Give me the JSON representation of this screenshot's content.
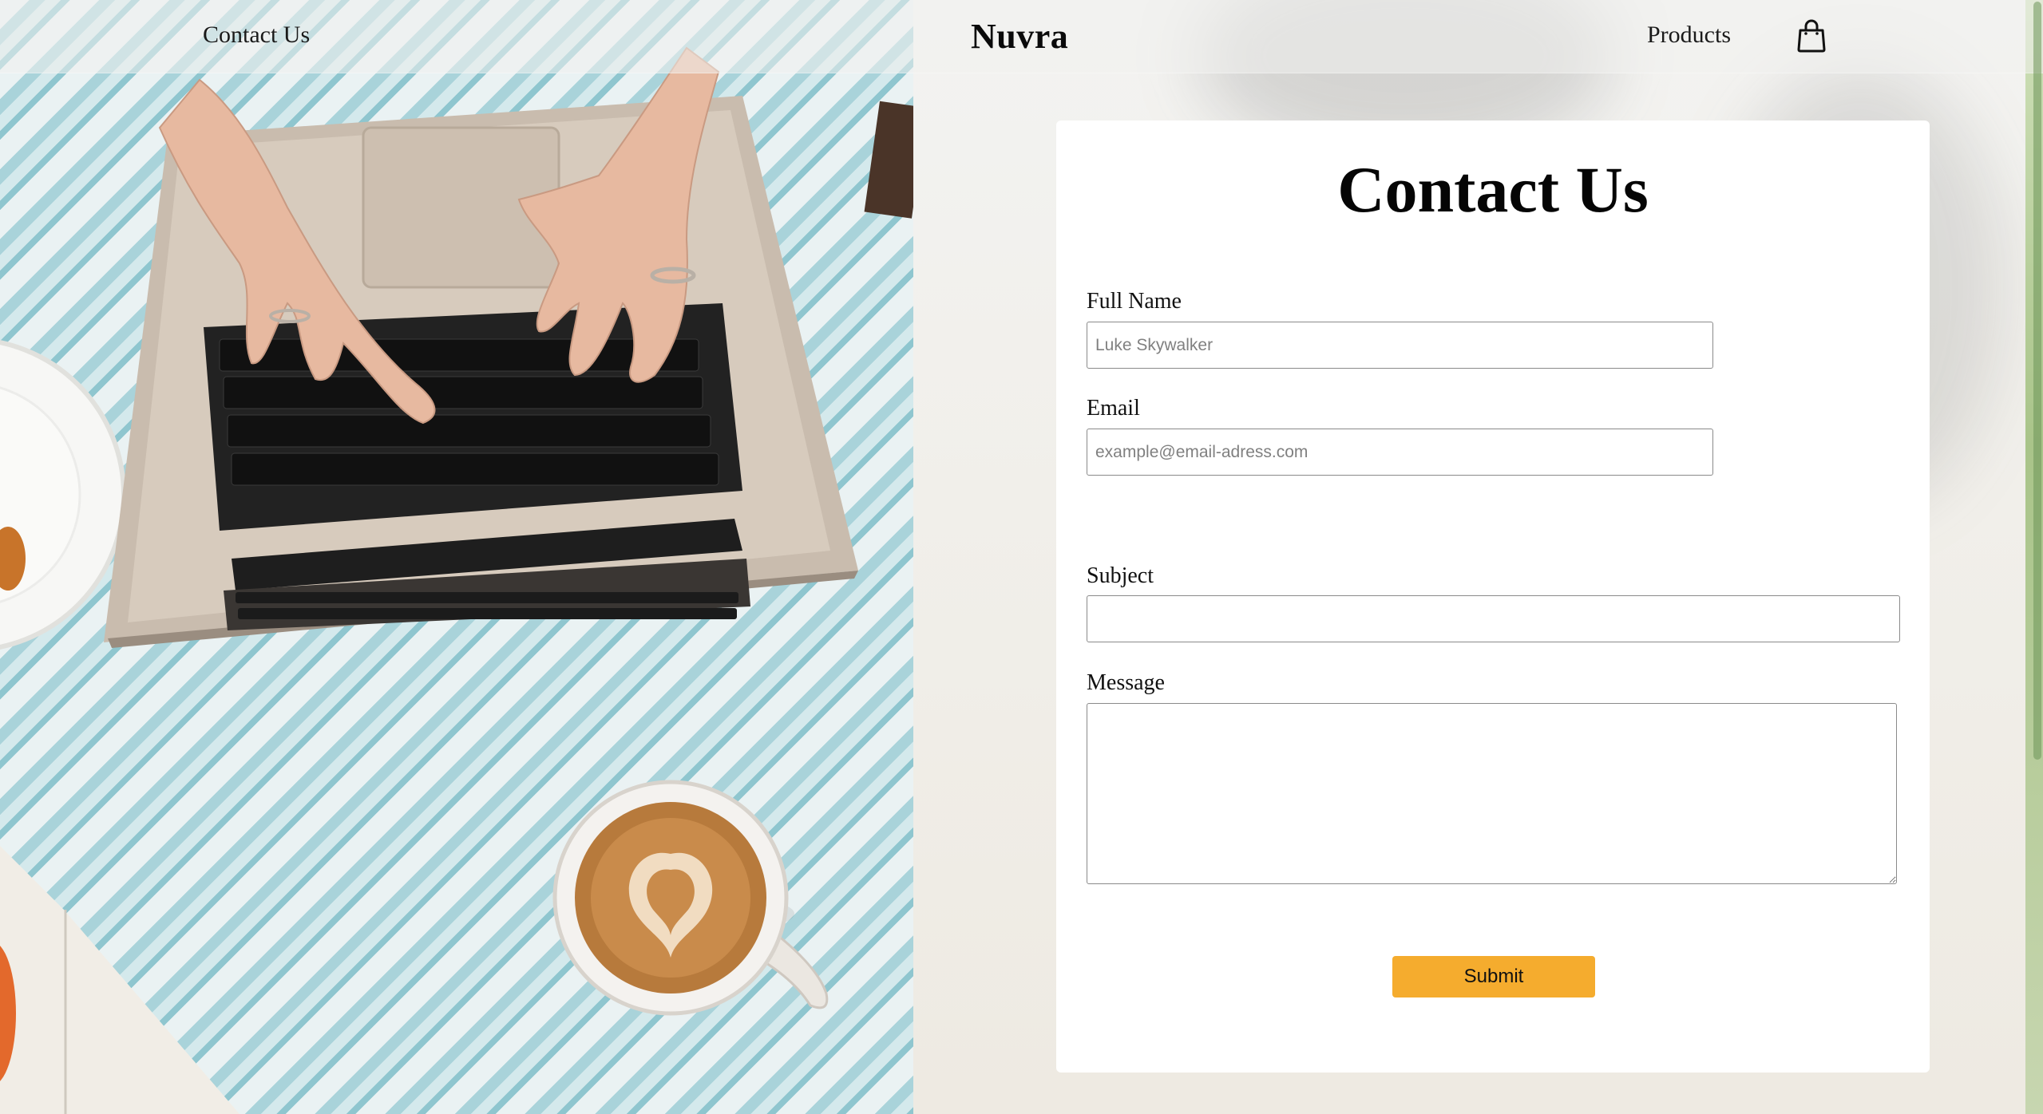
{
  "header": {
    "nav_contact": "Contact Us",
    "brand": "Nuvra",
    "nav_products": "Products",
    "cart_icon": "shopping-bag-icon"
  },
  "hero_image": {
    "description_icon": "photo-laptop-coffee"
  },
  "form": {
    "title": "Contact Us",
    "fields": {
      "full_name": {
        "label": "Full Name",
        "placeholder": "Luke Skywalker",
        "value": ""
      },
      "email": {
        "label": "Email",
        "placeholder": "example@email-adress.com",
        "value": ""
      },
      "subject": {
        "label": "Subject",
        "placeholder": "",
        "value": ""
      },
      "message": {
        "label": "Message",
        "placeholder": "",
        "value": ""
      }
    },
    "submit_label": "Submit"
  },
  "colors": {
    "accent": "#f5ac2e",
    "card": "#ffffff",
    "stripe": "#a9d3da"
  }
}
